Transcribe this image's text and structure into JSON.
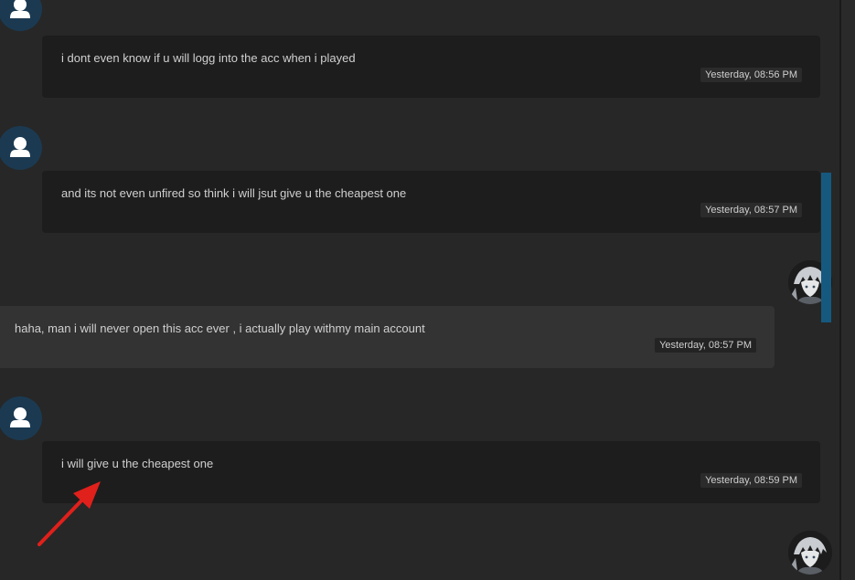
{
  "messages": [
    {
      "sender": "other",
      "text": "i dont even know if u will logg into the acc when i played",
      "time": "Yesterday, 08:56 PM"
    },
    {
      "sender": "other",
      "text": "and its not even unfired so think i will jsut give u the cheapest one",
      "time": "Yesterday, 08:57 PM"
    },
    {
      "sender": "self",
      "text": "haha, man i will never open this acc ever , i actually play withmy main account",
      "time": "Yesterday, 08:57 PM"
    },
    {
      "sender": "other",
      "text": "i will give u the cheapest one",
      "time": "Yesterday, 08:59 PM"
    }
  ],
  "icons": {
    "default_avatar": "user-silhouette-icon",
    "self_avatar": "anime-character-avatar"
  },
  "colors": {
    "background": "#272727",
    "incoming_bubble": "#1d1d1d",
    "outgoing_bubble": "#333333",
    "scrollbar_thumb": "#16597f",
    "annotation_arrow": "#e0201b"
  }
}
